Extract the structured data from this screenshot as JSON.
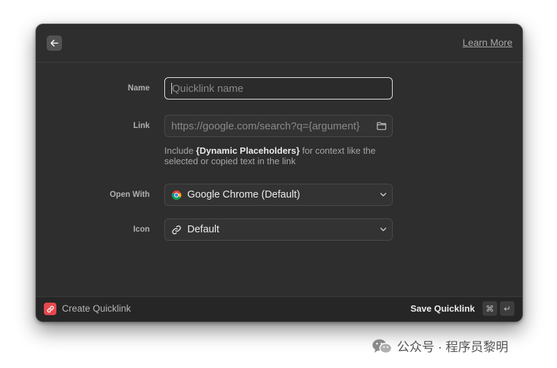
{
  "header": {
    "back_icon": "arrow-left-icon",
    "learn_more": "Learn More"
  },
  "form": {
    "name": {
      "label": "Name",
      "placeholder": "Quicklink name",
      "value": ""
    },
    "link": {
      "label": "Link",
      "placeholder": "https://google.com/search?q={argument}",
      "trailing_icon": "folder-icon",
      "hint_prefix": "Include ",
      "hint_highlight": "{Dynamic Placeholders}",
      "hint_suffix": " for context like the selected or copied text in the link"
    },
    "open_with": {
      "label": "Open With",
      "value": "Google Chrome (Default)",
      "icon": "chrome-icon"
    },
    "icon": {
      "label": "Icon",
      "value": "Default",
      "icon": "link-icon"
    }
  },
  "footer": {
    "title": "Create Quicklink",
    "save_label": "Save Quicklink",
    "keys": [
      "⌘",
      "↵"
    ],
    "accent": "#e5484d"
  },
  "watermark": {
    "text": "公众号 · 程序员黎明"
  }
}
